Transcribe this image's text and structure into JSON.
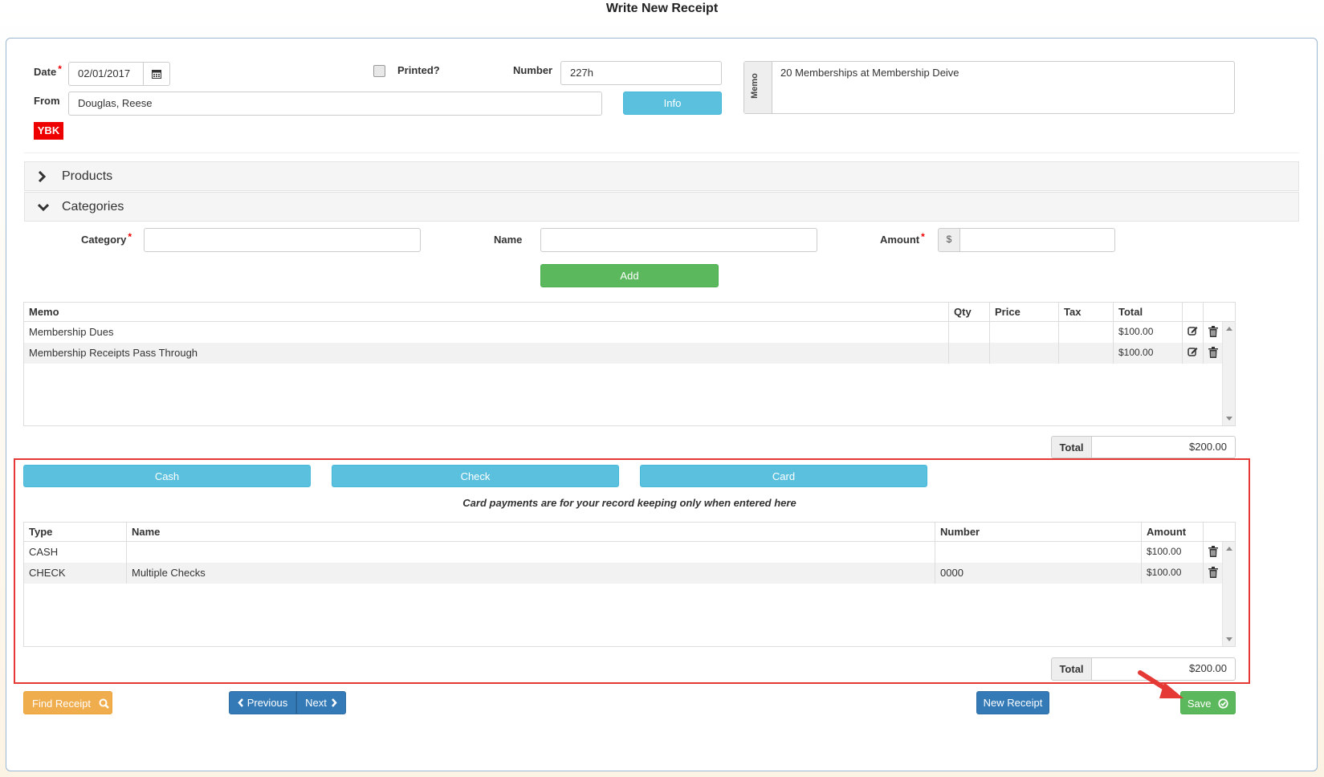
{
  "page": {
    "title": "Write New Receipt"
  },
  "header": {
    "date_label": "Date",
    "date_value": "02/01/2017",
    "printed_label": "Printed?",
    "number_label": "Number",
    "number_value": "227h",
    "from_label": "From",
    "from_value": "Douglas, Reese",
    "info_label": "Info",
    "badge": "YBK",
    "memo_side_label": "Memo",
    "memo_value": "20 Memberships at Membership Deive"
  },
  "sections": {
    "products": "Products",
    "categories": "Categories"
  },
  "category_form": {
    "category_label": "Category",
    "name_label": "Name",
    "amount_label": "Amount",
    "currency": "$",
    "add_label": "Add"
  },
  "items_table": {
    "headers": {
      "memo": "Memo",
      "qty": "Qty",
      "price": "Price",
      "tax": "Tax",
      "total": "Total"
    },
    "rows": [
      {
        "memo": "Membership Dues",
        "qty": "",
        "price": "",
        "tax": "",
        "total": "$100.00"
      },
      {
        "memo": "Membership Receipts Pass Through",
        "qty": "",
        "price": "",
        "tax": "",
        "total": "$100.00"
      }
    ],
    "total_label": "Total",
    "total_value": "$200.00"
  },
  "payment": {
    "cash_label": "Cash",
    "check_label": "Check",
    "card_label": "Card",
    "note": "Card payments are for your record keeping only when entered here",
    "headers": {
      "type": "Type",
      "name": "Name",
      "number": "Number",
      "amount": "Amount"
    },
    "rows": [
      {
        "type": "CASH",
        "name": "",
        "number": "",
        "amount": "$100.00"
      },
      {
        "type": "CHECK",
        "name": "Multiple Checks",
        "number": "0000",
        "amount": "$100.00"
      }
    ],
    "total_label": "Total",
    "total_value": "$200.00"
  },
  "footer": {
    "find_label": "Find Receipt",
    "previous_label": "Previous",
    "next_label": "Next",
    "new_label": "New Receipt",
    "save_label": "Save"
  },
  "colors": {
    "highlight": "#e53935",
    "arrow": "#e53935",
    "badge": "#ee0000"
  }
}
